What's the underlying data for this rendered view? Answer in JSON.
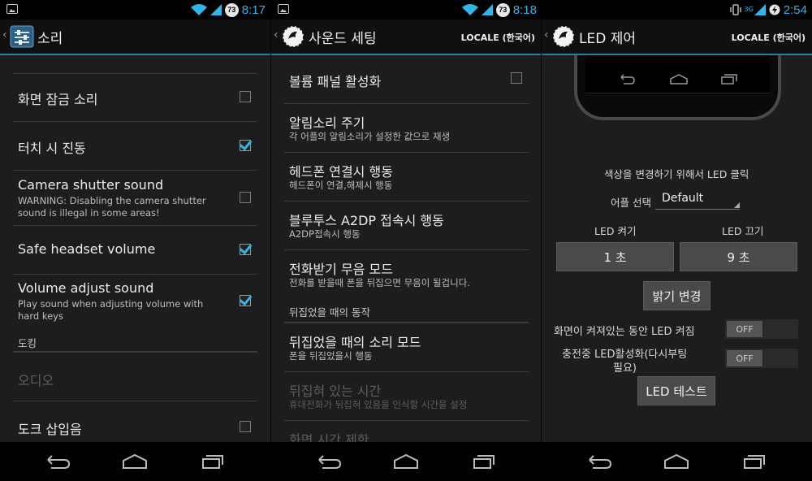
{
  "panel1": {
    "status": {
      "time": "8:17",
      "badge": "73"
    },
    "title": "소리",
    "items": [
      {
        "title": "화면 잠금 소리",
        "checked": false
      },
      {
        "title": "터치 시 진동",
        "checked": true
      },
      {
        "title": "Camera shutter sound",
        "summary": "WARNING: Disabling the camera shutter sound is illegal in some areas!",
        "checked": false
      },
      {
        "title": "Safe headset volume",
        "checked": true
      },
      {
        "title": "Volume adjust sound",
        "summary": "Play sound when adjusting volume with hard keys",
        "checked": true
      }
    ],
    "section_dock": "도킹",
    "audio_label": "오디오",
    "dock_insert": {
      "title": "도크 삽입음",
      "checked": false
    }
  },
  "panel2": {
    "status": {
      "time": "8:18",
      "badge": "73"
    },
    "title": "사운드 세팅",
    "locale": "LOCALE (한국어)",
    "items": [
      {
        "title": "볼륨 패널 활성화",
        "checked": false
      },
      {
        "title": "알림소리 주기",
        "summary": "각 어플의 알림소리가 설정한 값으로 재생"
      },
      {
        "title": "헤드폰 연결시 행동",
        "summary": "헤드폰이 연결,해제시 행동"
      },
      {
        "title": "블루투스 A2DP 접속시 행동",
        "summary": "A2DP접속시 행동"
      },
      {
        "title": "전화받기 무음 모드",
        "summary": "전화를 받을때 폰을 뒤집으면 무음이 될겁니다."
      }
    ],
    "section_flip": "뒤집었을 때의 동작",
    "flip_items": [
      {
        "title": "뒤집었을 때의 소리 모드",
        "summary": "폰을 뒤집었을시 행동"
      },
      {
        "title": "뒤집혀 있는 시간",
        "summary": "휴대전화가 뒤집혀 있음을 인식할 시간을 설정"
      },
      {
        "title": "화면 시간 제한"
      }
    ]
  },
  "panel3": {
    "status": {
      "time": "2:54",
      "network": "3G"
    },
    "title": "LED 제어",
    "locale": "LOCALE (한국어)",
    "click_hint": "색상을 변경하기 위해서 LED 클릭",
    "app_select_label": "어플 선택",
    "app_select_value": "Default",
    "led_on_label": "LED 켜기",
    "led_off_label": "LED 끄기",
    "led_on_value": "1 초",
    "led_off_value": "9 초",
    "brightness_button": "밝기 변경",
    "screen_on_label": "화면이 켜져있는 동안 LED 켜짐",
    "screen_on_toggle": "OFF",
    "charging_label_1": "충전중 LED활성화(다시부팅",
    "charging_label_2": "필요)",
    "charging_toggle": "OFF",
    "test_button": "LED 테스트"
  }
}
